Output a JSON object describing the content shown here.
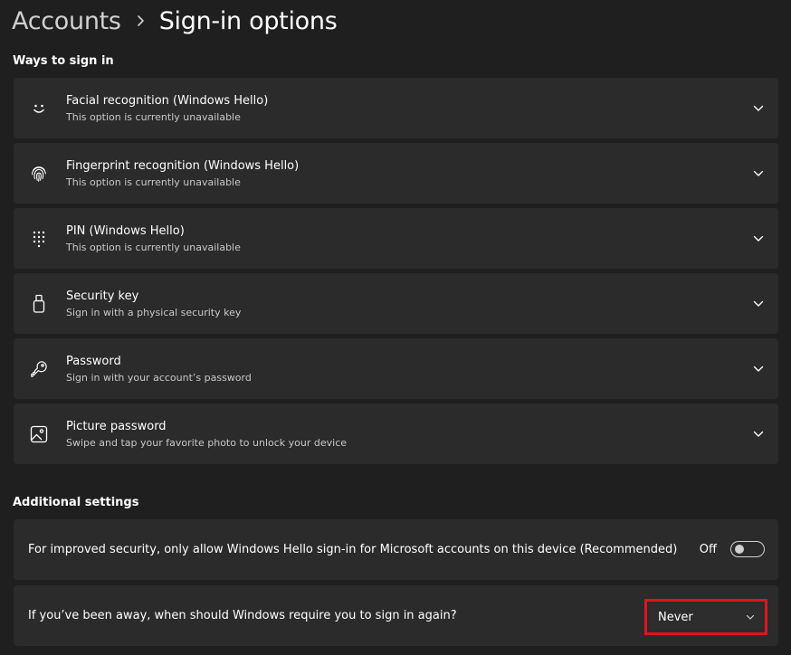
{
  "breadcrumb": {
    "parent": "Accounts",
    "separator_icon": "chevron-right-icon",
    "current": "Sign-in options"
  },
  "ways_section": {
    "title": "Ways to sign in",
    "options": [
      {
        "title": "Facial recognition (Windows Hello)",
        "subtitle": "This option is currently unavailable",
        "icon": "smiley-face-icon"
      },
      {
        "title": "Fingerprint recognition (Windows Hello)",
        "subtitle": "This option is currently unavailable",
        "icon": "fingerprint-icon"
      },
      {
        "title": "PIN (Windows Hello)",
        "subtitle": "This option is currently unavailable",
        "icon": "pin-keypad-icon"
      },
      {
        "title": "Security key",
        "subtitle": "Sign in with a physical security key",
        "icon": "usb-key-icon"
      },
      {
        "title": "Password",
        "subtitle": "Sign in with your account’s password",
        "icon": "key-icon"
      },
      {
        "title": "Picture password",
        "subtitle": "Swipe and tap your favorite photo to unlock your device",
        "icon": "picture-icon"
      }
    ]
  },
  "additional_section": {
    "title": "Additional settings",
    "hello_only": {
      "label": "For improved security, only allow Windows Hello sign-in for Microsoft accounts on this device (Recommended)",
      "state_label": "Off",
      "enabled": false
    },
    "require_signin": {
      "label": "If you’ve been away, when should Windows require you to sign in again?",
      "selected": "Never"
    }
  },
  "colors": {
    "background": "#1f1f1f",
    "card": "#2b2b2b",
    "highlight": "#e1141e"
  }
}
